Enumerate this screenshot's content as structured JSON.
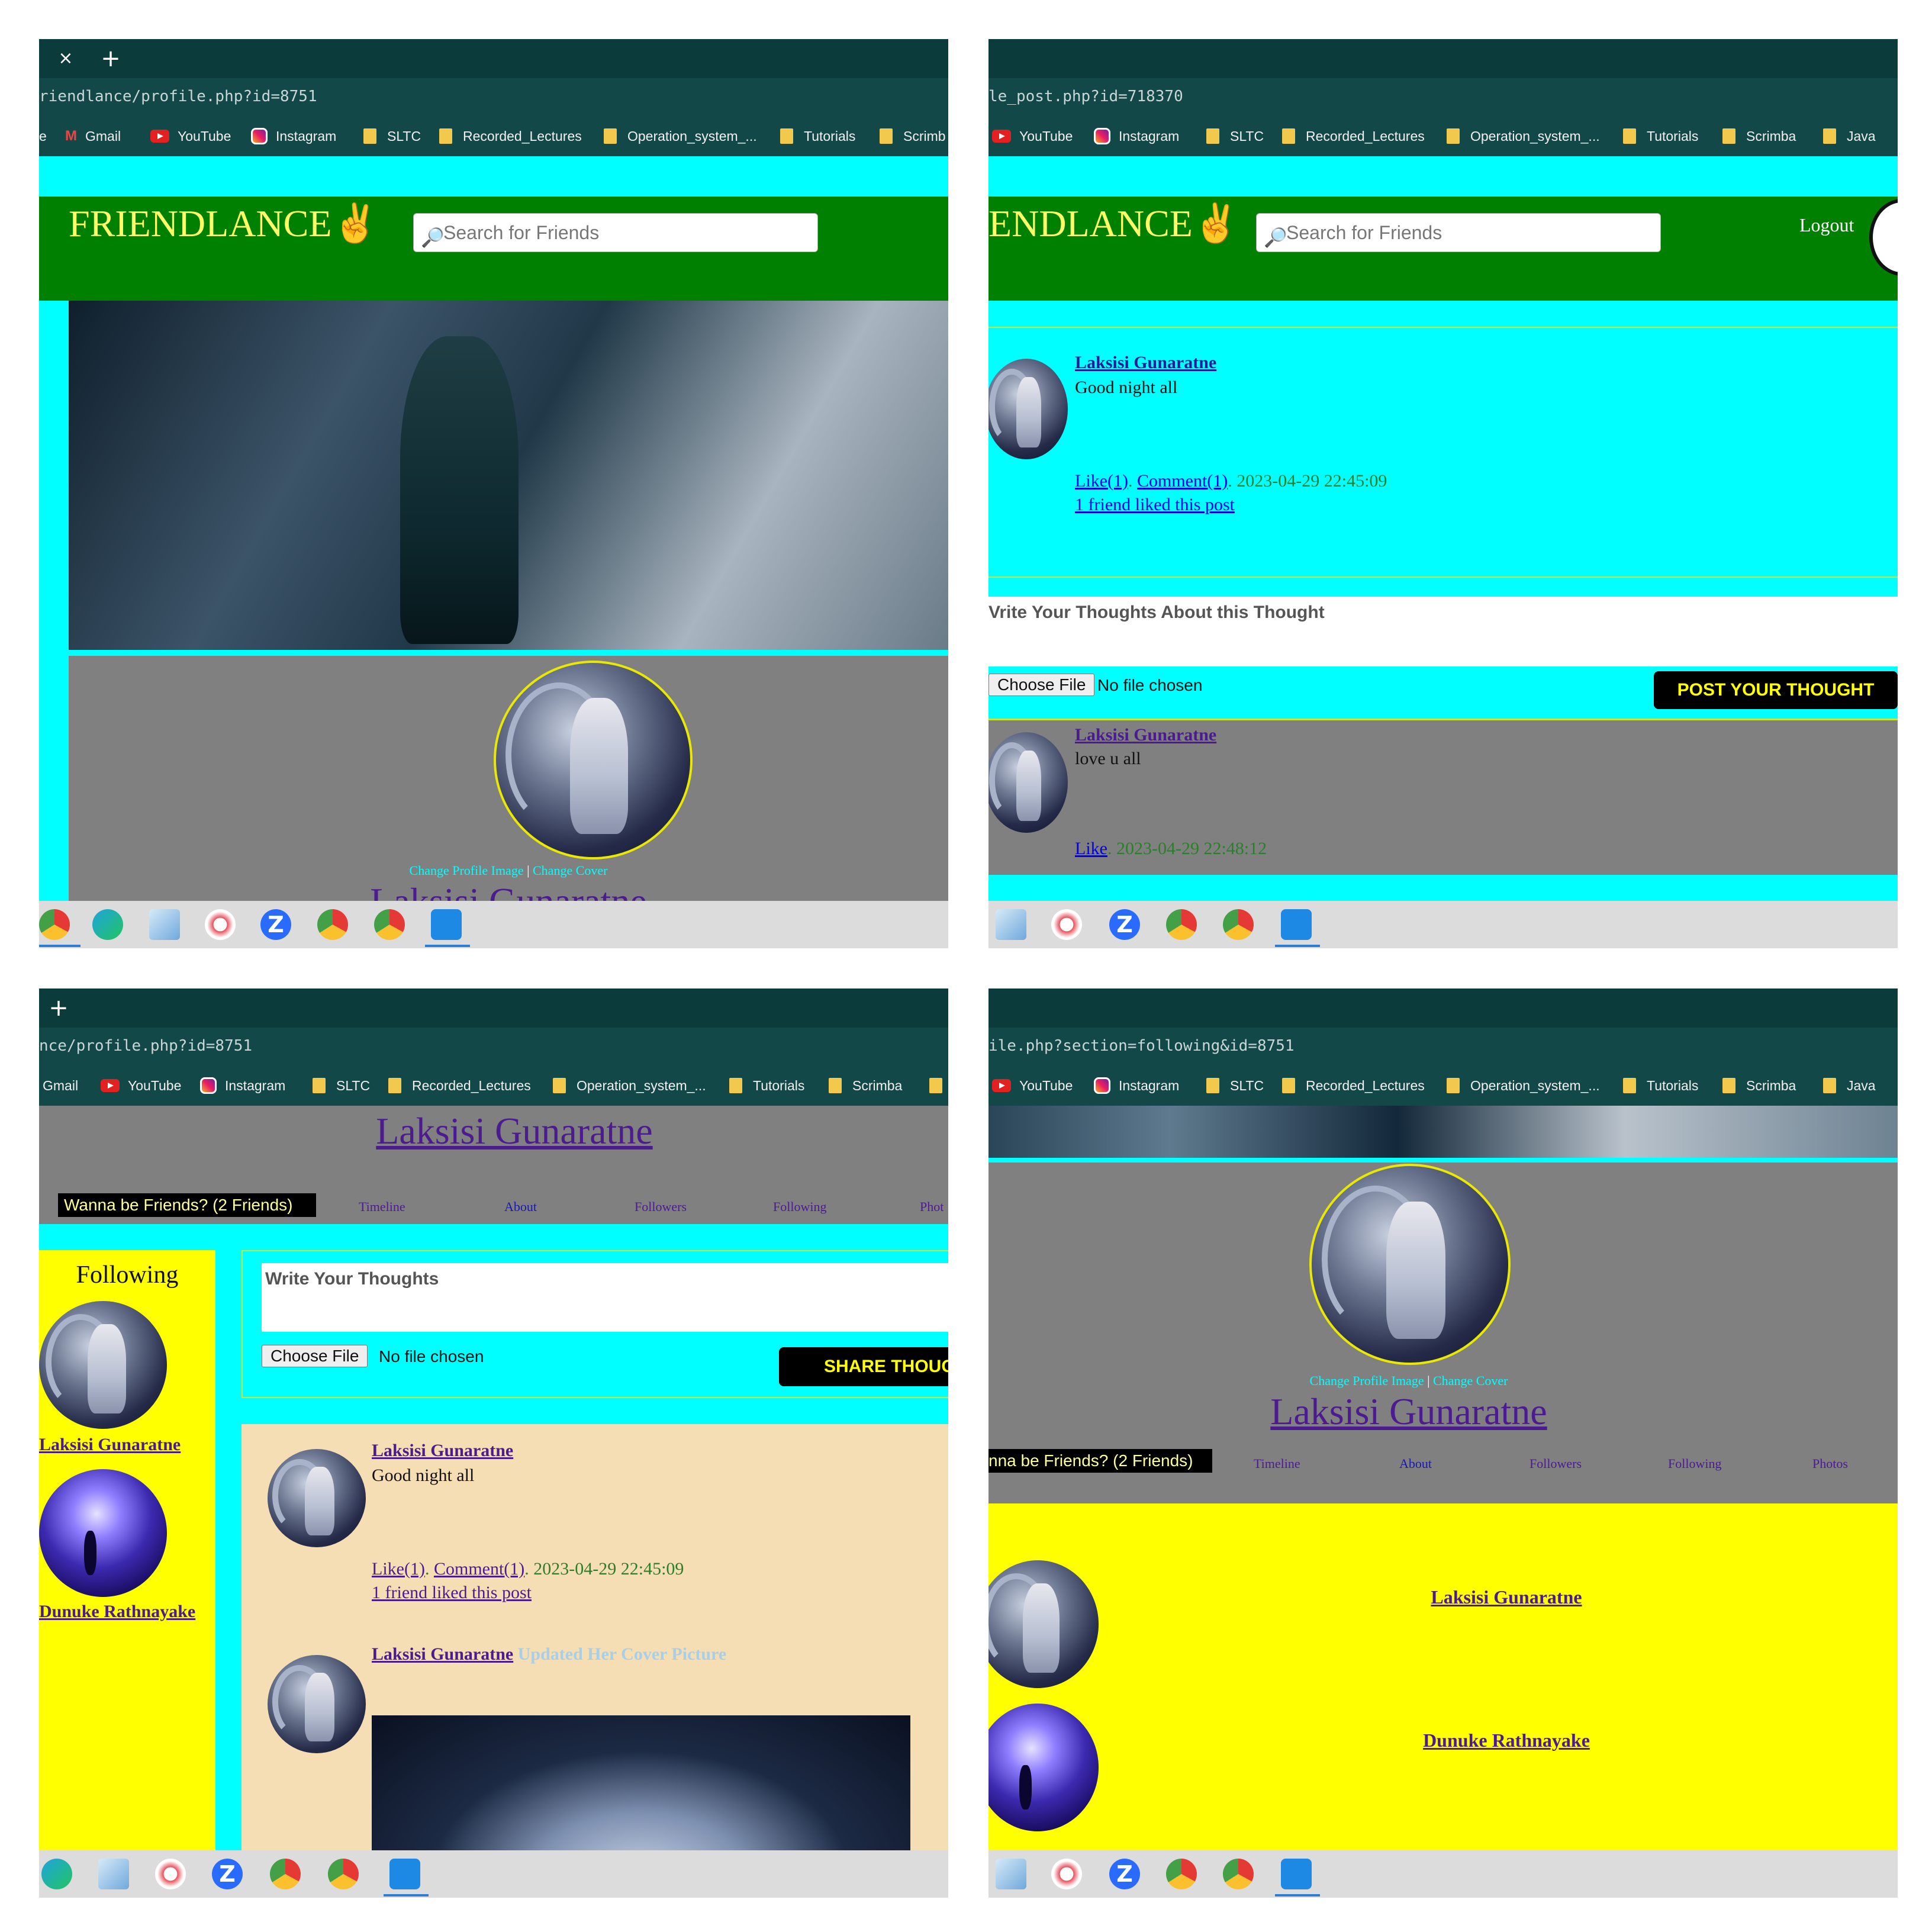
{
  "browser": {
    "tab_close": "×",
    "tab_new": "+",
    "urls": [
      "riendlance/profile.php?id=8751",
      "le_post.php?id=718370",
      "nce/profile.php?id=8751",
      "ile.php?section=following&id=8751"
    ],
    "bookmarks": {
      "p1": [
        "e",
        "Gmail",
        "YouTube",
        "Instagram",
        "SLTC",
        "Recorded_Lectures",
        "Operation_system_...",
        "Tutorials",
        "Scrimb"
      ],
      "p2": [
        "YouTube",
        "Instagram",
        "SLTC",
        "Recorded_Lectures",
        "Operation_system_...",
        "Tutorials",
        "Scrimba",
        "Java"
      ],
      "p3": [
        "Gmail",
        "YouTube",
        "Instagram",
        "SLTC",
        "Recorded_Lectures",
        "Operation_system_...",
        "Tutorials",
        "Scrimba"
      ],
      "p4": [
        "YouTube",
        "Instagram",
        "SLTC",
        "Recorded_Lectures",
        "Operation_system_...",
        "Tutorials",
        "Scrimba",
        "Java"
      ]
    }
  },
  "site": {
    "logo": "FRIENDLANCE",
    "logo_partial": "ENDLANCE",
    "search_placeholder": "Search for Friends",
    "logout": "Logout"
  },
  "profile": {
    "name": "Laksisi Gunaratne",
    "change_profile_image": "Change Profile Image",
    "separator": "|",
    "change_cover": "Change Cover",
    "wanna_friends": "Wanna be Friends? (2 Friends)",
    "wanna_friends_partial": "nna be Friends? (2 Friends)",
    "tabs": [
      "Timeline",
      "About",
      "Followers",
      "Following",
      "Photos"
    ],
    "tab_photos_partial": "Phot"
  },
  "single_post": {
    "author": "Laksisi Gunaratne",
    "text": "Good night all",
    "like": "Like(1)",
    "comment": "Comment(1)",
    "sep": ".",
    "timestamp": "2023-04-29 22:45:09",
    "liked_by": "1 friend liked this post",
    "comment_placeholder": "Vrite Your Thoughts About this Thought",
    "choose_file": "Choose File",
    "no_file": "No file chosen",
    "post_button": "POST YOUR THOUGHT",
    "comment_author": "Laksisi Gunaratne",
    "comment_text": "love u all",
    "comment_like": "Like",
    "comment_timestamp": "2023-04-29 22:48:12"
  },
  "timeline": {
    "following_title": "Following",
    "following": [
      "Laksisi Gunaratne",
      "Dunuke Rathnayake"
    ],
    "following_partial": [
      "Laksisi Gunaratne",
      "Dunuke Rathnayake"
    ],
    "write_placeholder": "Write Your Thoughts",
    "choose_file": "Choose File",
    "no_file": "No file chosen",
    "share_button": "SHARE THOUG",
    "post1_author": "Laksisi Gunaratne",
    "post1_text": "Good night all",
    "post1_like": "Like(1)",
    "post1_comment": "Comment(1)",
    "post1_timestamp": "2023-04-29 22:45:09",
    "post1_liked_by": "1 friend liked this post",
    "post2_author": "Laksisi Gunaratne",
    "post2_action": "Updated Her Cover Picture"
  },
  "following_section": {
    "names": [
      "Laksisi Gunaratne",
      "Dunuke Rathnayake"
    ]
  },
  "colors": {
    "accent_cyan": "#00ffff",
    "header_green": "#008000",
    "sidebar_yellow": "#ffff00",
    "feed_wheat": "#f5deb3"
  }
}
